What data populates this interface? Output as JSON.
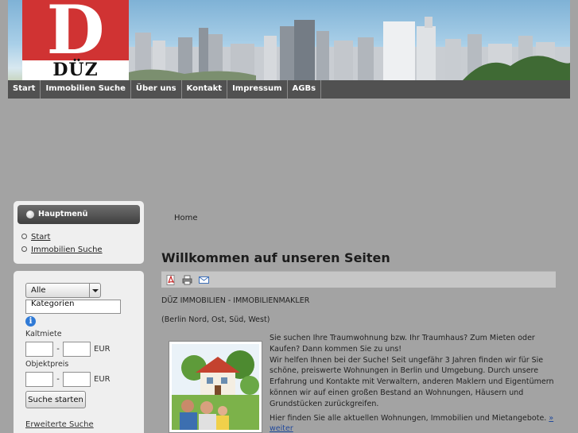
{
  "logo": {
    "letter": "D",
    "text": "DÜZ"
  },
  "nav": {
    "items": [
      {
        "label": "Start"
      },
      {
        "label": "Immobilien Suche"
      },
      {
        "label": "Über uns"
      },
      {
        "label": "Kontakt"
      },
      {
        "label": "Impressum"
      },
      {
        "label": "AGBs"
      }
    ]
  },
  "menu": {
    "title": "Hauptmenü",
    "items": [
      {
        "label": "Start"
      },
      {
        "label": "Immobilien Suche"
      }
    ]
  },
  "search": {
    "category_selected": "Alle Kategorien",
    "info_glyph": "i",
    "kaltmiete_label": "Kaltmiete",
    "objektpreis_label": "Objektpreis",
    "dash": "-",
    "currency": "EUR",
    "button_label": "Suche starten",
    "advanced_link": "Erweiterte Suche"
  },
  "content": {
    "breadcrumb": "Home",
    "title": "Willkommen auf unseren Seiten",
    "company_line": "DÜZ IMMOBILIEN - IMMOBILIENMAKLER",
    "region_line": "(Berlin Nord, Ost, Süd, West)",
    "intro": "Sie suchen  Ihre Traumwohnung bzw. Ihr Traumhaus? Zum Mieten oder Kaufen? Dann kommen Sie zu uns!",
    "body": "Wir helfen Ihnen bei der Suche! Seit ungefähr 3 Jahren finden wir für Sie schöne, preiswerte Wohnungen in Berlin und Umgebung. Durch unsere Erfahrung und Kontakte mit Verwaltern, anderen Maklern und Eigentümern können wir auf einen großen Bestand an Wohnungen, Häusern und Grundstücken zurückgreifen.",
    "offer_text": "Hier finden Sie alle aktuellen Wohnungen, Immobilien und Mietangebote.",
    "more_link": "» weiter"
  },
  "colors": {
    "background": "#a3a3a3",
    "nav": "#515151",
    "logo_red": "#d03333",
    "link_blue": "#224a9c"
  }
}
